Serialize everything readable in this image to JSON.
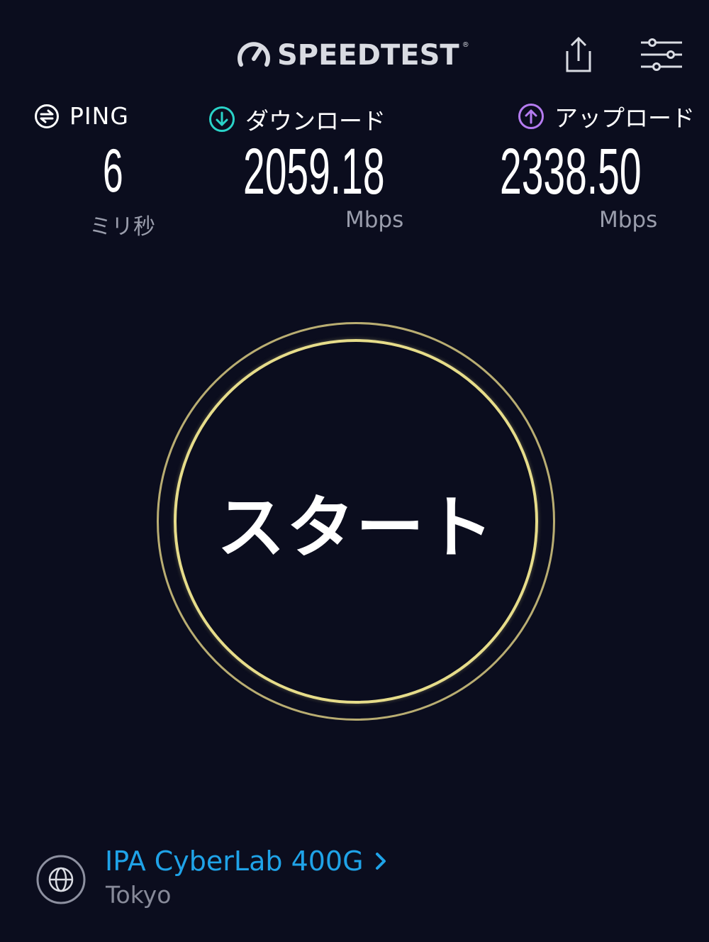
{
  "header": {
    "logo_text": "SPEEDTEST",
    "logo_tm": "®",
    "share_icon": "share-icon",
    "settings_icon": "settings-sliders-icon"
  },
  "metrics": {
    "ping": {
      "label": "PING",
      "value": "6",
      "unit": "ミリ秒",
      "icon": "ping-icon",
      "color": "#ffffff"
    },
    "download": {
      "label": "ダウンロード",
      "value": "2059.18",
      "unit": "Mbps",
      "icon": "download-arrow-icon",
      "color": "#2ad3c8"
    },
    "upload": {
      "label": "アップロード",
      "value": "2338.50",
      "unit": "Mbps",
      "icon": "upload-arrow-icon",
      "color": "#b57bf0"
    }
  },
  "start_button": {
    "label": "スタート",
    "ring_color": "#e6dc8a"
  },
  "server": {
    "name": "IPA CyberLab 400G",
    "location": "Tokyo",
    "icon": "globe-icon",
    "accent_color": "#1fa3e8"
  }
}
